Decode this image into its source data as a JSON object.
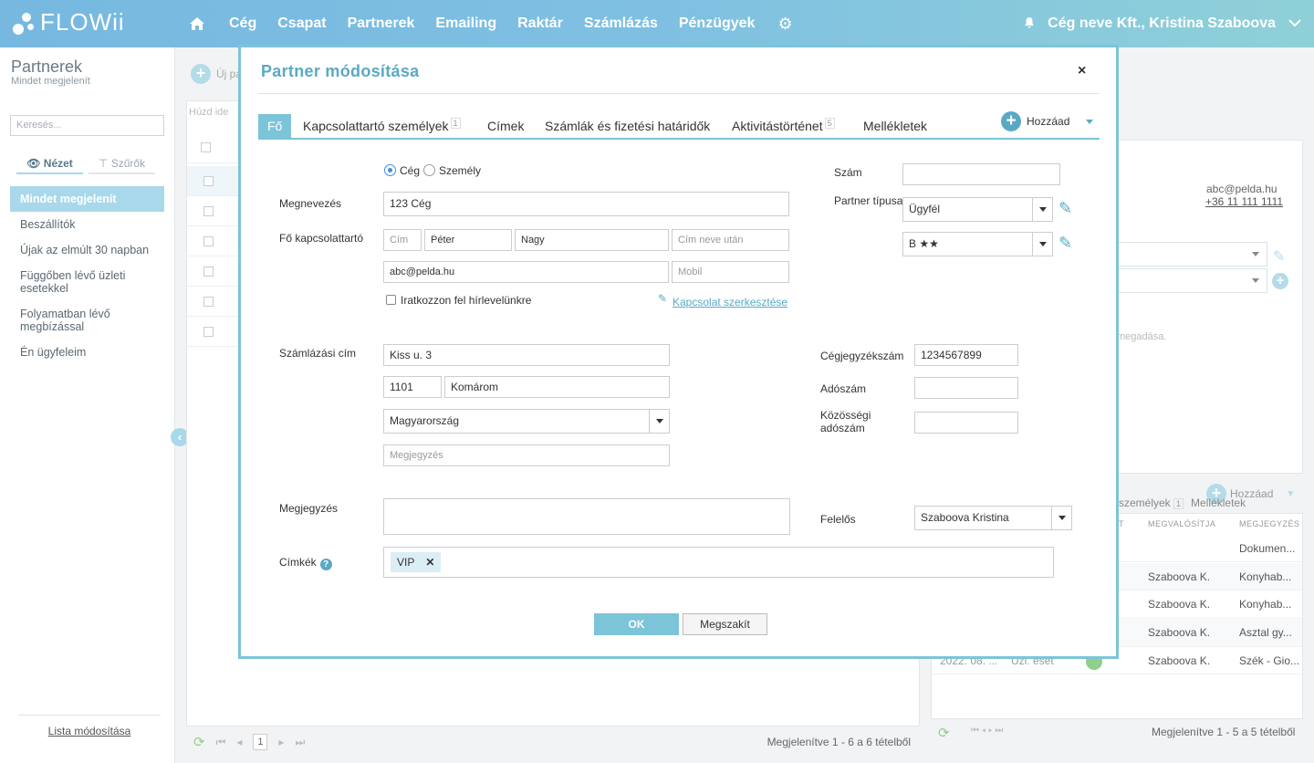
{
  "header": {
    "logo": "FLOWii",
    "nav": [
      "Cég",
      "Csapat",
      "Partnerek",
      "Emailing",
      "Raktár",
      "Számlázás",
      "Pénzügyek"
    ],
    "account": "Cég neve Kft., Kristina Szaboova",
    "icons": {
      "home": "home-icon",
      "settings": "gear-icon",
      "notifications": "bell-icon"
    }
  },
  "sidebar": {
    "title": "Partnerek",
    "subtitle": "Mindet megjelenít",
    "search_placeholder": "Keresés...",
    "tabs": [
      "Nézet",
      "Szűrők"
    ],
    "items": [
      "Mindet megjelenít",
      "Beszállítók",
      "Újak az elmúlt 30 napban",
      "Függőben lévő üzleti esetekkel",
      "Folyamatban lévő megbízással",
      "Én ügyfeleim"
    ],
    "bottom_link": "Lista módosítása"
  },
  "main": {
    "add_label": "Új pa",
    "drag_hint": "Húzd ide",
    "pager": {
      "page": "1",
      "summary": "Megjelenítve 1 - 6 a 6 tételből"
    }
  },
  "right_panel": {
    "email": "abc@pelda.hu",
    "phone": "+36 11 111 1111",
    "hint": "megadása.",
    "add_label": "Hozzáad",
    "tabs": {
      "persons": "személyek",
      "persons_count": "1",
      "attachments": "Mellékletek"
    },
    "columns": [
      "T",
      "MEGVALÓSÍTJA",
      "MEGJEGYZÉS"
    ],
    "rows": [
      {
        "date": "",
        "type": "",
        "owner": "",
        "note": "Dokumen..."
      },
      {
        "date": "",
        "type": "",
        "owner": "Szaboova K.",
        "note": "Konyhab..."
      },
      {
        "date": "",
        "type": "",
        "owner": "Szaboova K.",
        "note": "Konyhab..."
      },
      {
        "date": "",
        "type": "",
        "owner": "Szaboova K.",
        "note": "Asztal gy..."
      },
      {
        "date": "2022. 08. ...",
        "type": "Üzl. eset",
        "owner": "Szaboova K.",
        "note": "Szék - Gio..."
      }
    ],
    "pager_summary": "Megjelenítve 1 - 5 a 5 tételből"
  },
  "modal": {
    "title": "Partner módosítása",
    "close": "×",
    "tabs": [
      {
        "label": "Fő"
      },
      {
        "label": "Kapcsolattartó személyek",
        "badge": "1"
      },
      {
        "label": "Címek"
      },
      {
        "label": "Számlák és fizetési határidők"
      },
      {
        "label": "Aktivitástörténet",
        "badge": "5"
      },
      {
        "label": "Mellékletek"
      }
    ],
    "add_label": "Hozzáad",
    "type_options": {
      "company": "Cég",
      "person": "Személy",
      "selected": "Cég"
    },
    "name_label": "Megnevezés",
    "name_value": "123  Cég",
    "contact_label": "Fő kapcsolattartó",
    "contact": {
      "title_placeholder": "Cím",
      "first_name": "Péter",
      "last_name": "Nagy",
      "suffix_placeholder": "Cím neve után",
      "email": "abc@pelda.hu",
      "mobile_placeholder": "Mobil"
    },
    "newsletter_label": "Iratkozzon fel hírlevelünkre",
    "edit_contact_link": "Kapcsolat szerkesztése",
    "number_label": "Szám",
    "number_value": "",
    "partner_type_label": "Partner típusa",
    "partner_type_value": "Ügyfél",
    "rating_value": "B ★★",
    "billing_label": "Számlázási cím",
    "billing": {
      "street": "Kiss u. 3",
      "zip": "1101",
      "city": "Komárom",
      "country": "Magyarország",
      "note_placeholder": "Megjegyzés"
    },
    "reg_number_label": "Cégjegyzékszám",
    "reg_number_value": "1234567899",
    "tax_label": "Adószám",
    "tax_value": "",
    "eu_tax_label": "Közösségi adószám",
    "eu_tax_value": "",
    "note_label": "Megjegyzés",
    "note_value": "",
    "responsible_label": "Felelős",
    "responsible_value": "Szaboova Kristina",
    "tags_label": "Címkék",
    "tags": [
      "VIP"
    ],
    "ok": "OK",
    "cancel": "Megszakít"
  }
}
